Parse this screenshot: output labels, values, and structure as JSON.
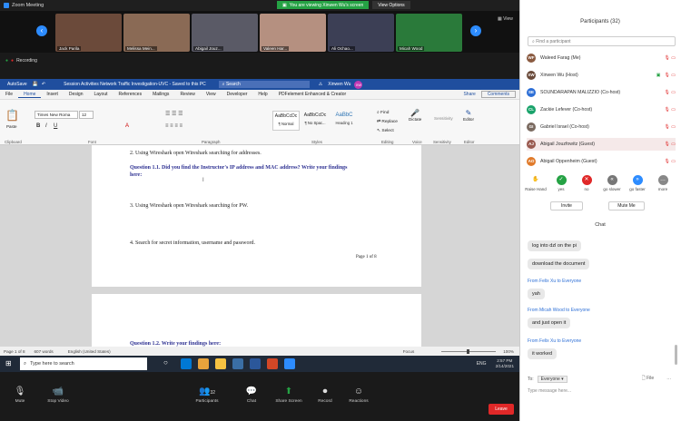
{
  "app": {
    "title": "Zoom Meeting"
  },
  "share_bar": {
    "sharing": "You are viewing Xinwen Wu's screen",
    "view_options": "View Options"
  },
  "gallery": {
    "tiles": [
      {
        "name": "Jack Parila",
        "color": "#6b4a3a"
      },
      {
        "name": "Melissa Mein...",
        "color": "#8a6a55"
      },
      {
        "name": "Abigail Jouz...",
        "color": "#5a5a66"
      },
      {
        "name": "Valeen Har...",
        "color": "#b59080"
      },
      {
        "name": "Ali Ochao...",
        "color": "#3c3f55"
      },
      {
        "name": "Micah Wood",
        "color": "#2a7a3a"
      }
    ],
    "view_label": "View"
  },
  "recording": {
    "label": "Recording"
  },
  "word": {
    "autosave": "AutoSave",
    "title": "Session Activities Network Traffic Investigation-UVC - Saved to this PC",
    "search": "Search",
    "user": "Xinwen Wu",
    "user_initials": "XW",
    "menu": [
      "File",
      "Home",
      "Insert",
      "Design",
      "Layout",
      "References",
      "Mailings",
      "Review",
      "View",
      "Developer",
      "Help",
      "PDFelement Enhanced & Creator"
    ],
    "share": "Share",
    "comments": "Comments",
    "font_name": "Times New Roma",
    "font_size": "12",
    "styles": [
      {
        "sample": "AaBbCcDc",
        "name": "¶ Normal"
      },
      {
        "sample": "AaBbCcDc",
        "name": "¶ No Spac..."
      },
      {
        "sample": "AaBbC",
        "name": "Heading 1"
      }
    ],
    "find": "Find",
    "replace": "Replace",
    "select": "Select",
    "dictate": "Dictate",
    "sensitivity": "Sensitivity",
    "editor": "Editor",
    "groups": [
      "Clipboard",
      "Font",
      "Paragraph",
      "Styles",
      "Editing",
      "Voice",
      "Sensitivity",
      "Editor"
    ],
    "paste": "Paste",
    "doc": {
      "step2": "2.   Using Wireshark open Wireshark searching for addresses.",
      "q11": "Question 1.1.  Did you find the Instructor's IP address and MAC address?  Write your findings",
      "q11b": "here:",
      "step3": "3.   Using Wireshark open Wireshark searching for PW.",
      "step4": "4.   Search for secret information, username and password.",
      "pagenum": "Page 1 of 8",
      "q12": "Question 1.2.  Write your findings here:"
    },
    "status": {
      "page": "Page 1 of 8",
      "words": "607 words",
      "lang": "English (United States)",
      "focus": "Focus",
      "zoom": "100%"
    }
  },
  "taskbar": {
    "search": "Type here to search",
    "lang": "ENG",
    "time": "2:57 PM",
    "date": "2/14/2021"
  },
  "controls": {
    "mute": "Mute",
    "video": "Stop Video",
    "participants": "Participants",
    "participants_count": "32",
    "chat": "Chat",
    "share": "Share Screen",
    "record": "Record",
    "reactions": "Reactions",
    "leave": "Leave"
  },
  "participants": {
    "title": "Participants (32)",
    "search_placeholder": "Find a participant",
    "list": [
      {
        "name": "Waleed Farag (Me)",
        "initials": "WF",
        "color": "#8a5a40"
      },
      {
        "name": "Xinwen Wu (Host)",
        "initials": "XW",
        "color": "#6a4a3a"
      },
      {
        "name": "SOUNDARAPAN MALIZZIO (Co-host)",
        "initials": "SE",
        "color": "#2d6fd6"
      },
      {
        "name": "Zackie Lefever (Co-host)",
        "initials": "CL",
        "color": "#1aa36b"
      },
      {
        "name": "Gabriel Israel (Co-host)",
        "initials": "GI",
        "color": "#7a6a60"
      },
      {
        "name": "Abigail Jouzfowitz (Guest)",
        "initials": "AJ",
        "color": "#9a5a50"
      },
      {
        "name": "Abigail Oppenheim (Guest)",
        "initials": "AO",
        "color": "#e07a2a"
      }
    ],
    "reactions": [
      {
        "label": "Raise Hand",
        "color": "#2d8cff",
        "glyph": "✋"
      },
      {
        "label": "yes",
        "color": "#25a244",
        "glyph": "✓"
      },
      {
        "label": "no",
        "color": "#e02828",
        "glyph": "✕"
      },
      {
        "label": "go slower",
        "color": "#777777",
        "glyph": "«"
      },
      {
        "label": "go faster",
        "color": "#2d8cff",
        "glyph": "»"
      },
      {
        "label": "more",
        "color": "#888888",
        "glyph": "…"
      }
    ],
    "invite": "Invite",
    "mute_all": "Mute Me"
  },
  "chat": {
    "title": "Chat",
    "msg1": "log into dzl on the pi",
    "msg2": "download the document",
    "from1": "From Felix Xu to Everyone",
    "msg3": "yah",
    "from2": "From Micah Wood to Everyone",
    "msg4": "and just open it",
    "from3": "From Felix Xu to Everyone",
    "msg5": "it worked",
    "to_label": "To:",
    "to_value": "Everyone",
    "file": "File",
    "placeholder": "Type message here..."
  }
}
